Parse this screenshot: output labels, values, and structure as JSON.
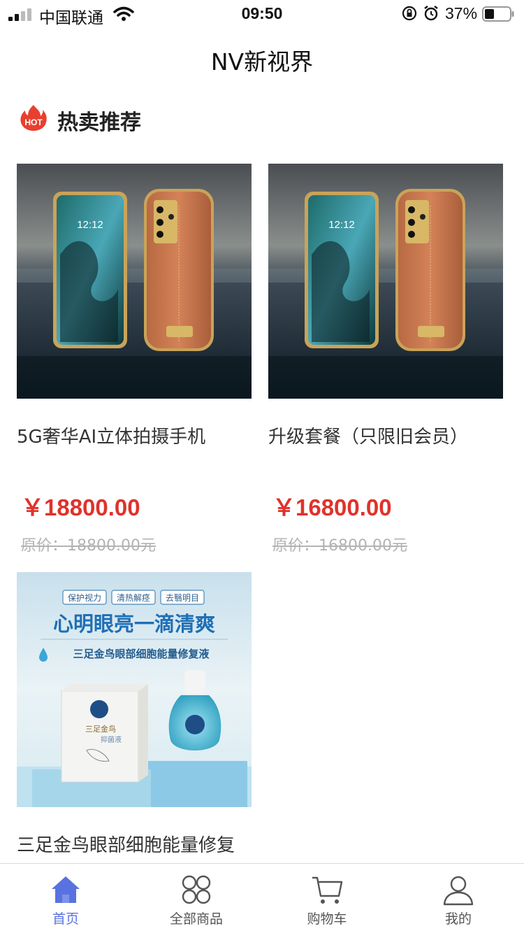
{
  "status_bar": {
    "carrier": "中国联通",
    "time": "09:50",
    "battery": "37%"
  },
  "nav": {
    "title": "NV新视界"
  },
  "section": {
    "icon_text": "HOT",
    "title": "热卖推荐"
  },
  "products": [
    {
      "name": "5G奢华AI立体拍摄手机",
      "price": "￥18800.00",
      "original_price": "原价：18800.00元",
      "screen_time": "12:12"
    },
    {
      "name": "升级套餐（只限旧会员）",
      "price": "￥16800.00",
      "original_price": "原价：16800.00元",
      "screen_time": "12:12"
    },
    {
      "name": "三足金鸟眼部细胞能量修复",
      "tags": [
        "保护视力",
        "清热解痉",
        "去翳明目"
      ],
      "headline": "心明眼亮一滴清爽",
      "subline": "三足金鸟眼部细胞能量修复液",
      "box_title": "三足金鸟",
      "box_sub": "抑菌液"
    }
  ],
  "tabbar": {
    "items": [
      {
        "label": "首页",
        "icon": "home-icon",
        "active": true
      },
      {
        "label": "全部商品",
        "icon": "grid-icon",
        "active": false
      },
      {
        "label": "购物车",
        "icon": "cart-icon",
        "active": false
      },
      {
        "label": "我的",
        "icon": "user-icon",
        "active": false
      }
    ]
  },
  "colors": {
    "price_red": "#e0322b",
    "accent_blue": "#5872e0",
    "hot_red": "#e8402f"
  }
}
